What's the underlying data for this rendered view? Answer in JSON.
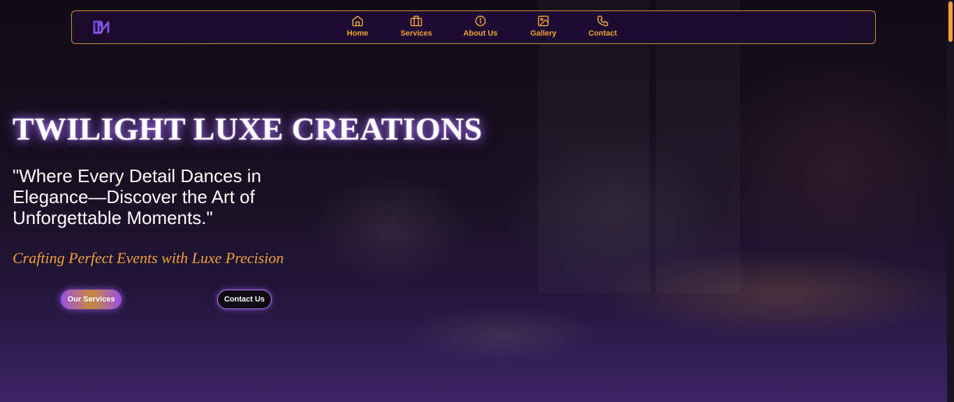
{
  "nav": {
    "logo_alt": "DM",
    "items": [
      {
        "label": "Home",
        "icon": "home-icon"
      },
      {
        "label": "Services",
        "icon": "briefcase-icon"
      },
      {
        "label": "About Us",
        "icon": "info-icon"
      },
      {
        "label": "Gallery",
        "icon": "image-icon"
      },
      {
        "label": "Contact",
        "icon": "phone-icon"
      }
    ]
  },
  "hero": {
    "title": "TWILIGHT LUXE CREATIONS",
    "quote": "\"Where Every Detail Dances in Elegance—Discover the Art of Unforgettable Moments.\"",
    "tagline": "Crafting Perfect Events with Luxe Precision",
    "primary_button": "Our Services",
    "secondary_button": "Contact Us"
  },
  "colors": {
    "accent": "#f2a13a",
    "glow": "#b07aff",
    "nav_bg": "#1a0a2c"
  }
}
